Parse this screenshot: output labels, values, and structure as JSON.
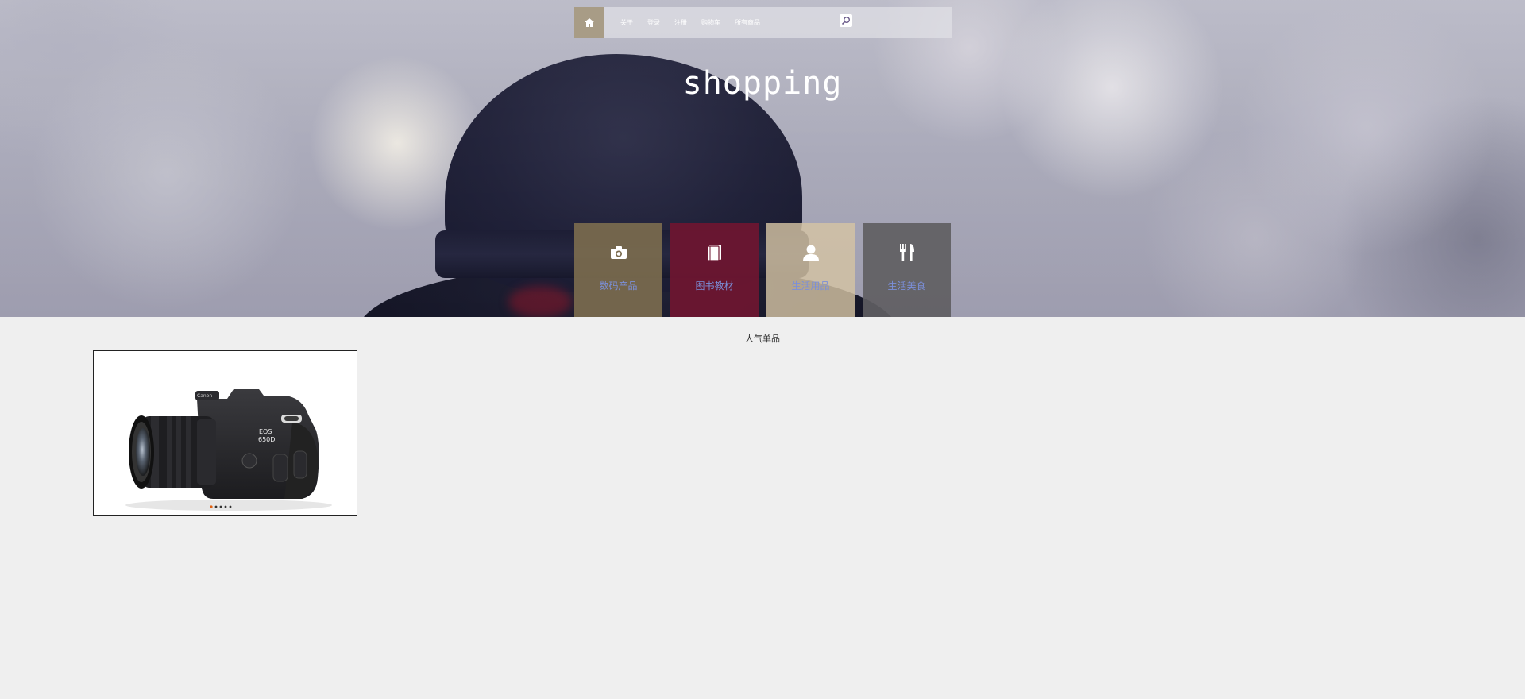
{
  "nav": {
    "links": [
      "关于",
      "登录",
      "注册",
      "购物车",
      "所有商品"
    ]
  },
  "site": {
    "title": "shopping"
  },
  "categories": [
    {
      "label": "数码产品",
      "icon": "camera-icon",
      "color": "#7b6b4e"
    },
    {
      "label": "图书教材",
      "icon": "book-icon",
      "color": "#6e1630"
    },
    {
      "label": "生活用品",
      "icon": "user-icon",
      "color": "#cbbb9d"
    },
    {
      "label": "生活美食",
      "icon": "fork-knife-icon",
      "color": "#5f5e62"
    }
  ],
  "main": {
    "section_title": "人气单品",
    "product": {
      "model_text_1": "EOS",
      "model_text_2": "650D",
      "brand_text": "Canon"
    }
  },
  "colors": {
    "page_bg": "#efefef",
    "home_button": "#a89c86",
    "label_blue": "#7b8fd9"
  }
}
